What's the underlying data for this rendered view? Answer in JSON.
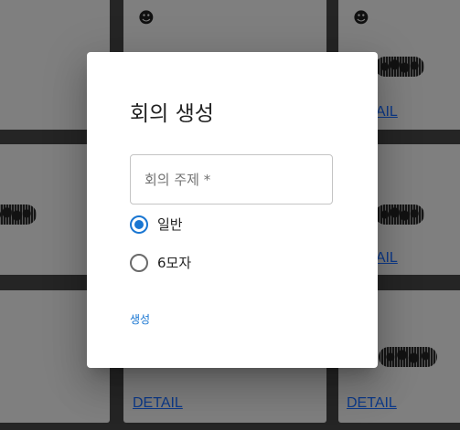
{
  "background": {
    "cards": [
      {
        "id": "c1",
        "has_smile": false,
        "detail": ""
      },
      {
        "id": "c2",
        "has_smile": true,
        "detail": ""
      },
      {
        "id": "c3",
        "has_smile": true,
        "detail": "DETAIL"
      },
      {
        "id": "c4",
        "has_smile": false,
        "detail": ""
      },
      {
        "id": "c5",
        "has_smile": false,
        "detail": ""
      },
      {
        "id": "c6",
        "has_smile": false,
        "detail": "DETAIL"
      },
      {
        "id": "c7",
        "has_smile": false,
        "detail": ""
      },
      {
        "id": "c8",
        "has_smile": false,
        "detail": "DETAIL"
      },
      {
        "id": "c9",
        "has_smile": false,
        "detail": "DETAIL"
      }
    ],
    "smile_glyph": "☻",
    "link_color": "#0d3a8a"
  },
  "dialog": {
    "title": "회의 생성",
    "topic_field": {
      "value": "",
      "placeholder": "회의 주제 *"
    },
    "options": [
      {
        "label": "일반",
        "checked": true
      },
      {
        "label": "6모자",
        "checked": false
      }
    ],
    "create_label": "생성",
    "accent_color": "#1976d2"
  }
}
